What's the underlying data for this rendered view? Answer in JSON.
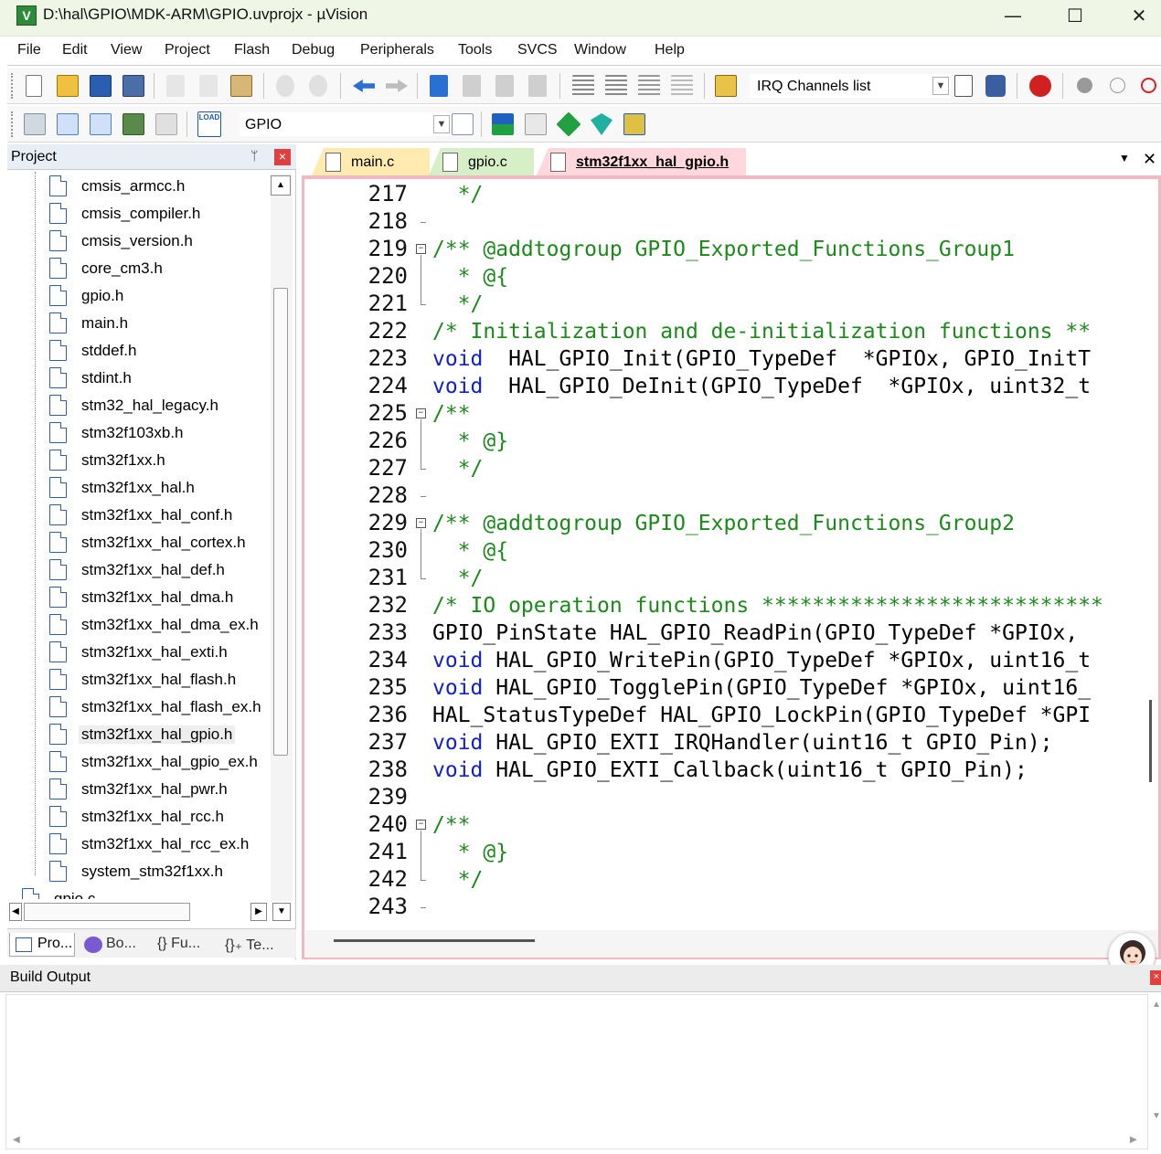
{
  "window": {
    "title": "D:\\hal\\GPIO\\MDK-ARM\\GPIO.uvprojx - µVision",
    "app_icon": "V",
    "minimize": "—",
    "maximize": "☐",
    "close": "✕"
  },
  "menu": [
    "File",
    "Edit",
    "View",
    "Project",
    "Flash",
    "Debug",
    "Peripherals",
    "Tools",
    "SVCS",
    "Window",
    "Help"
  ],
  "toolbar1": {
    "irq_combo": "IRQ Channels list",
    "icons": [
      "new-file-icon",
      "open-file-icon",
      "save-icon",
      "save-all-icon",
      "cut-icon",
      "copy-icon",
      "paste-icon",
      "undo-icon",
      "redo-icon",
      "nav-back-icon",
      "nav-forward-icon",
      "bookmark-icon",
      "bookmark-prev-icon",
      "bookmark-next-icon",
      "bookmark-clear-icon",
      "indent-icon",
      "unindent-icon",
      "comment-icon",
      "uncomment-icon",
      "find-in-files-icon",
      "find-icon",
      "incremental-find-icon",
      "debug-session-icon",
      "breakpoint-icon",
      "breakpoint-disable-icon",
      "breakpoint-kill-icon"
    ]
  },
  "toolbar2": {
    "target_combo": "GPIO",
    "load_label": "LOAD"
  },
  "project_panel": {
    "title": "Project",
    "pin": "ᛘ",
    "close": "×",
    "files": [
      "cmsis_armcc.h",
      "cmsis_compiler.h",
      "cmsis_version.h",
      "core_cm3.h",
      "gpio.h",
      "main.h",
      "stddef.h",
      "stdint.h",
      "stm32_hal_legacy.h",
      "stm32f103xb.h",
      "stm32f1xx.h",
      "stm32f1xx_hal.h",
      "stm32f1xx_hal_conf.h",
      "stm32f1xx_hal_cortex.h",
      "stm32f1xx_hal_def.h",
      "stm32f1xx_hal_dma.h",
      "stm32f1xx_hal_dma_ex.h",
      "stm32f1xx_hal_exti.h",
      "stm32f1xx_hal_flash.h",
      "stm32f1xx_hal_flash_ex.h",
      "stm32f1xx_hal_gpio.h",
      "stm32f1xx_hal_gpio_ex.h",
      "stm32f1xx_hal_pwr.h",
      "stm32f1xx_hal_rcc.h",
      "stm32f1xx_hal_rcc_ex.h",
      "system_stm32f1xx.h"
    ],
    "selected_file": "stm32f1xx_hal_gpio.h",
    "partial_item": "gpio.c",
    "tabs": [
      "Pro...",
      "Bo...",
      "{} Fu...",
      "{}₊ Te..."
    ]
  },
  "editor": {
    "tabs": [
      "main.c",
      "gpio.c",
      "stm32f1xx_hal_gpio.h"
    ],
    "active_tab": "stm32f1xx_hal_gpio.h",
    "lines": [
      {
        "n": "217",
        "code": [
          {
            "t": "  */",
            "c": "cm"
          }
        ]
      },
      {
        "n": "218",
        "code": []
      },
      {
        "n": "219",
        "fold": "-",
        "code": [
          {
            "t": "/** @addtogroup GPIO_Exported_Functions_Group1",
            "c": "cm"
          }
        ]
      },
      {
        "n": "220",
        "code": [
          {
            "t": "  * @{",
            "c": "cm"
          }
        ]
      },
      {
        "n": "221",
        "code": [
          {
            "t": "  */",
            "c": "cm"
          }
        ]
      },
      {
        "n": "222",
        "code": [
          {
            "t": "/* Initialization and de-initialization functions **",
            "c": "cm"
          }
        ]
      },
      {
        "n": "223",
        "code": [
          {
            "t": "void",
            "c": "kw"
          },
          {
            "t": "  HAL_GPIO_Init(GPIO_TypeDef  *GPIOx, GPIO_InitT",
            "c": ""
          }
        ]
      },
      {
        "n": "224",
        "code": [
          {
            "t": "void",
            "c": "kw"
          },
          {
            "t": "  HAL_GPIO_DeInit(GPIO_TypeDef  *GPIOx, uint32_t",
            "c": ""
          }
        ]
      },
      {
        "n": "225",
        "fold": "-",
        "code": [
          {
            "t": "/**",
            "c": "cm"
          }
        ]
      },
      {
        "n": "226",
        "code": [
          {
            "t": "  * @}",
            "c": "cm"
          }
        ]
      },
      {
        "n": "227",
        "code": [
          {
            "t": "  */",
            "c": "cm"
          }
        ]
      },
      {
        "n": "228",
        "code": []
      },
      {
        "n": "229",
        "fold": "-",
        "code": [
          {
            "t": "/** @addtogroup GPIO_Exported_Functions_Group2",
            "c": "cm"
          }
        ]
      },
      {
        "n": "230",
        "code": [
          {
            "t": "  * @{",
            "c": "cm"
          }
        ]
      },
      {
        "n": "231",
        "code": [
          {
            "t": "  */",
            "c": "cm"
          }
        ]
      },
      {
        "n": "232",
        "code": [
          {
            "t": "/* IO operation functions ***************************",
            "c": "cm"
          }
        ]
      },
      {
        "n": "233",
        "code": [
          {
            "t": "GPIO_PinState HAL_GPIO_ReadPin(GPIO_TypeDef *GPIOx,",
            "c": ""
          }
        ]
      },
      {
        "n": "234",
        "code": [
          {
            "t": "void",
            "c": "kw"
          },
          {
            "t": " HAL_GPIO_WritePin(GPIO_TypeDef *GPIOx, uint16_t",
            "c": ""
          }
        ]
      },
      {
        "n": "235",
        "code": [
          {
            "t": "void",
            "c": "kw"
          },
          {
            "t": " HAL_GPIO_TogglePin(GPIO_TypeDef *GPIOx, uint16_",
            "c": ""
          }
        ]
      },
      {
        "n": "236",
        "code": [
          {
            "t": "HAL_StatusTypeDef HAL_GPIO_LockPin(GPIO_TypeDef *GPI",
            "c": ""
          }
        ]
      },
      {
        "n": "237",
        "code": [
          {
            "t": "void",
            "c": "kw"
          },
          {
            "t": " HAL_GPIO_EXTI_IRQHandler(uint16_t GPIO_Pin);",
            "c": ""
          }
        ]
      },
      {
        "n": "238",
        "code": [
          {
            "t": "void",
            "c": "kw"
          },
          {
            "t": " HAL_GPIO_EXTI_Callback(uint16_t GPIO_Pin);",
            "c": ""
          }
        ]
      },
      {
        "n": "239",
        "code": []
      },
      {
        "n": "240",
        "fold": "-",
        "code": [
          {
            "t": "/**",
            "c": "cm"
          }
        ]
      },
      {
        "n": "241",
        "code": [
          {
            "t": "  * @}",
            "c": "cm"
          }
        ]
      },
      {
        "n": "242",
        "code": [
          {
            "t": "  */",
            "c": "cm"
          }
        ]
      },
      {
        "n": "243",
        "code": []
      }
    ]
  },
  "build_output": {
    "title": "Build Output",
    "close": "×"
  },
  "colors": {
    "keyword": "#1020d0",
    "comment": "#1b8a1b",
    "active_tab": "#ffd7dc",
    "main_tab": "#ffeab0",
    "gpioc_tab": "#d6efc6"
  }
}
